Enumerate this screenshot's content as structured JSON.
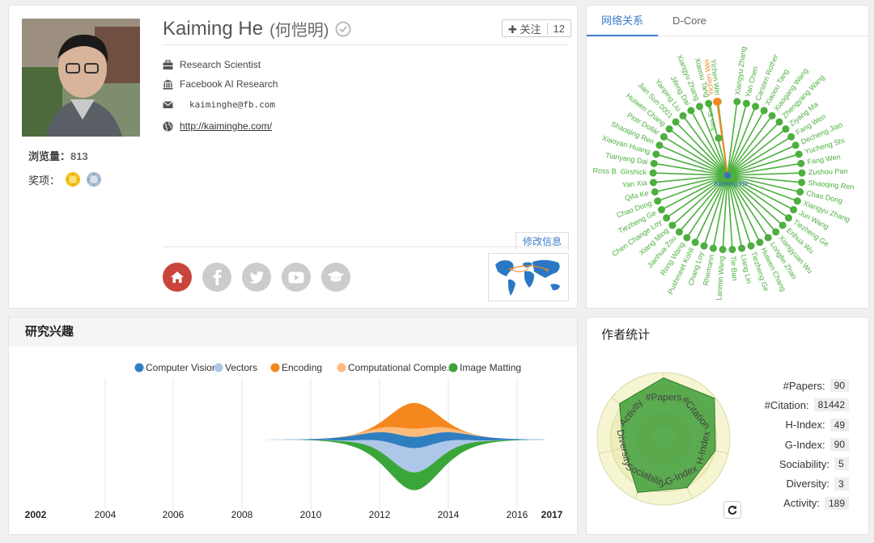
{
  "profile": {
    "name": "Kaiming He",
    "name_cn": "(何恺明)",
    "follow_label": "关注",
    "follow_count": "12",
    "position": "Research Scientist",
    "affiliation": "Facebook AI Research",
    "email": "kaiminghe@fb.com",
    "homepage": "http://kaiminghe.com/",
    "views_label": "浏览量：",
    "views_count": "813",
    "awards_label": "奖项：",
    "edit_label": "修改信息"
  },
  "network": {
    "tabs": [
      "网络关系",
      "D-Core"
    ],
    "center": "Kaiming He",
    "highlight": "Yichen Wei",
    "highlight_inner": "Jian Sun",
    "nodes": [
      "Xiangyu Zhang",
      "Yan Chen",
      "Carsten Rother",
      "Xiaoou Tang",
      "Xiaogang Wang",
      "Zhengyang Wang",
      "Ziyang Ma",
      "Fang Wen",
      "Decheng Jiao",
      "Yucheng Shi",
      "Fang Wen",
      "Zushou Pan",
      "Shaoqing Ren",
      "Chao Dong",
      "Xiangyu Zhang",
      "Jun Wang",
      "Tiezheng Ge",
      "Enhua Wu",
      "Xiangyuan Wu",
      "Longfei Zhao",
      "Huiwen Chang",
      "Tiezheng Ge",
      "Liang Lin",
      "Tie Ban",
      "Lanmin Wang",
      "Rhemann",
      "Chang Loy",
      "Pushmeet Kohli",
      "Rong Wang",
      "Jianhua Zou",
      "Xiang Ming",
      "Chen Change Loy",
      "Tiezheng Ge",
      "Chao Dong",
      "Qifa Ke",
      "Yan Xia",
      "Ross B. Girshick",
      "Tianyang Dai",
      "Xiaoyan Huang",
      "Shaoqing Ren",
      "Piotr Dollár",
      "Huiwen Chang",
      "Jian Sun 0001",
      "Yanping Liu",
      "Jifeng Dai",
      "Xiangyu Zhang",
      "Xiaoou Tang",
      "Yichen Wei"
    ]
  },
  "interests": {
    "title": "研究兴趣",
    "legend": [
      {
        "label": "Computer Vision",
        "color": "#2f7ec0"
      },
      {
        "label": "Vectors",
        "color": "#aec7e8"
      },
      {
        "label": "Encoding",
        "color": "#f5871f"
      },
      {
        "label": "Computational Comple...",
        "color": "#fdbb7d"
      },
      {
        "label": "Image Matting",
        "color": "#3aa63a"
      }
    ],
    "years": [
      "2002",
      "2004",
      "2006",
      "2008",
      "2010",
      "2012",
      "2014",
      "2016",
      "2017"
    ]
  },
  "stats": {
    "title": "作者统计",
    "axes": [
      "#Papers",
      "#Citation",
      "H-Index",
      "G-Index",
      "Sociability",
      "Diversity",
      "Activity"
    ],
    "rows": [
      {
        "label": "#Papers:",
        "value": "90"
      },
      {
        "label": "#Citation:",
        "value": "81442"
      },
      {
        "label": "H-Index:",
        "value": "49"
      },
      {
        "label": "G-Index:",
        "value": "90"
      },
      {
        "label": "Sociability:",
        "value": "5"
      },
      {
        "label": "Diversity:",
        "value": "3"
      },
      {
        "label": "Activity:",
        "value": "189"
      }
    ],
    "radar_levels": [
      0.92,
      0.98,
      0.8,
      0.82,
      0.9,
      0.62,
      0.85
    ]
  }
}
